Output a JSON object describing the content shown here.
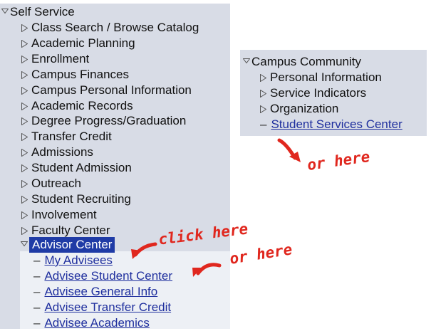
{
  "left_menu": {
    "root": "Self Service",
    "items": [
      "Class Search / Browse Catalog",
      "Academic Planning",
      "Enrollment",
      "Campus Finances",
      "Campus Personal Information",
      "Academic Records",
      "Degree Progress/Graduation",
      "Transfer Credit",
      "Admissions",
      "Student Admission",
      "Outreach",
      "Student Recruiting",
      "Involvement",
      "Faculty Center"
    ],
    "selected": "Advisor Center",
    "subitems": [
      "My Advisees",
      "Advisee Student Center",
      "Advisee General Info",
      "Advisee Transfer Credit",
      "Advisee Academics"
    ]
  },
  "right_menu": {
    "root": "Campus Community",
    "items": [
      "Personal Information",
      "Service Indicators",
      "Organization"
    ],
    "link": "Student Services Center"
  },
  "annotations": {
    "click_here": "click here",
    "or_here_1": "or here",
    "or_here_2": "or here"
  },
  "colors": {
    "panel": "#d8dce6",
    "submenu": "#edf0f5",
    "selected": "#1f3ba6",
    "link": "#1f2f9e",
    "annotation": "#e0271e"
  }
}
